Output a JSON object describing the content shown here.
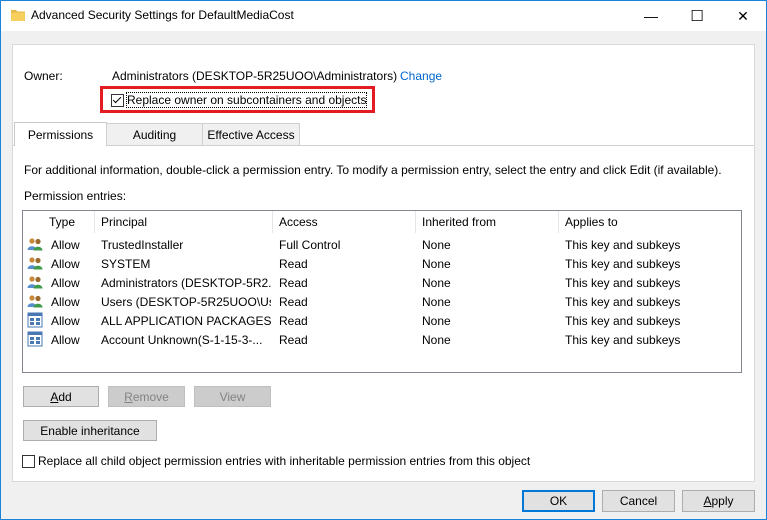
{
  "window": {
    "title": "Advanced Security Settings for DefaultMediaCost",
    "minimize": "—",
    "maximize": "☐",
    "close": "✕"
  },
  "owner": {
    "label": "Owner:",
    "value": "Administrators (DESKTOP-5R25UOO\\Administrators)",
    "change_link": "Change",
    "replace_checkbox_label": "Replace owner on subcontainers and objects",
    "replace_checked": true
  },
  "tabs": [
    {
      "label": "Permissions",
      "active": true
    },
    {
      "label": "Auditing",
      "active": false
    },
    {
      "label": "Effective Access",
      "active": false
    }
  ],
  "info_text": "For additional information, double-click a permission entry. To modify a permission entry, select the entry and click Edit (if available).",
  "entries_label": "Permission entries:",
  "columns": [
    "Type",
    "Principal",
    "Access",
    "Inherited from",
    "Applies to"
  ],
  "rows": [
    {
      "icon": "users-icon",
      "type": "Allow",
      "principal": "TrustedInstaller",
      "access": "Full Control",
      "inherited": "None",
      "applies": "This key and subkeys"
    },
    {
      "icon": "users-icon",
      "type": "Allow",
      "principal": "SYSTEM",
      "access": "Read",
      "inherited": "None",
      "applies": "This key and subkeys"
    },
    {
      "icon": "users-icon",
      "type": "Allow",
      "principal": "Administrators (DESKTOP-5R2...",
      "access": "Read",
      "inherited": "None",
      "applies": "This key and subkeys"
    },
    {
      "icon": "users-icon",
      "type": "Allow",
      "principal": "Users (DESKTOP-5R25UOO\\Us...",
      "access": "Read",
      "inherited": "None",
      "applies": "This key and subkeys"
    },
    {
      "icon": "app-package-icon",
      "type": "Allow",
      "principal": "ALL APPLICATION PACKAGES",
      "access": "Read",
      "inherited": "None",
      "applies": "This key and subkeys"
    },
    {
      "icon": "app-package-icon",
      "type": "Allow",
      "principal": "Account Unknown(S-1-15-3-...",
      "access": "Read",
      "inherited": "None",
      "applies": "This key and subkeys"
    }
  ],
  "buttons": {
    "add": "Add",
    "remove": "Remove",
    "view": "View",
    "enable_inheritance": "Enable inheritance",
    "ok": "OK",
    "cancel": "Cancel",
    "apply": "Apply"
  },
  "replace_child_label": "Replace all child object permission entries with inheritable permission entries from this object",
  "replace_child_checked": false,
  "colors": {
    "highlight": "#e31b23",
    "link": "#0066cc",
    "accent": "#0078d7"
  }
}
